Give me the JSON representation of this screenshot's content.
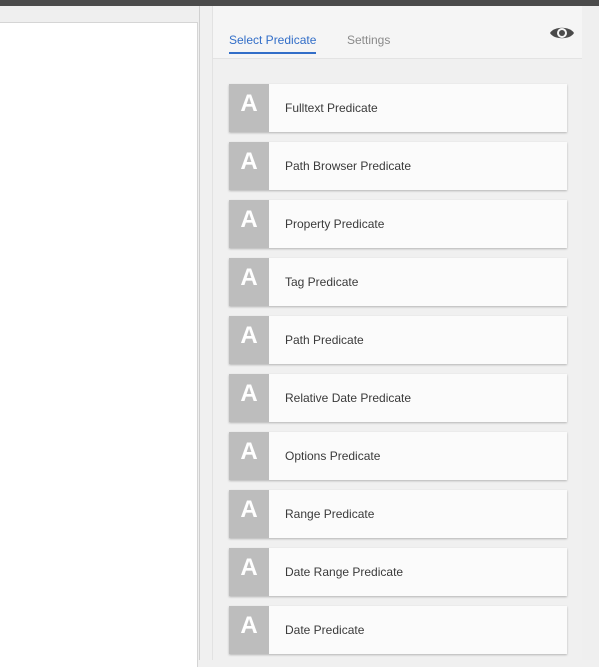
{
  "side_panel": {
    "tabs": [
      {
        "label": "Select Predicate",
        "active": true
      },
      {
        "label": "Settings",
        "active": false
      }
    ],
    "preview_icon": "eye-icon",
    "predicates": [
      {
        "badge": "A",
        "label": "Fulltext Predicate"
      },
      {
        "badge": "A",
        "label": "Path Browser Predicate"
      },
      {
        "badge": "A",
        "label": "Property Predicate"
      },
      {
        "badge": "A",
        "label": "Tag Predicate"
      },
      {
        "badge": "A",
        "label": "Path Predicate"
      },
      {
        "badge": "A",
        "label": "Relative Date Predicate"
      },
      {
        "badge": "A",
        "label": "Options Predicate"
      },
      {
        "badge": "A",
        "label": "Range Predicate"
      },
      {
        "badge": "A",
        "label": "Date Range Predicate"
      },
      {
        "badge": "A",
        "label": "Date Predicate"
      }
    ]
  },
  "colors": {
    "accent": "#326ec8",
    "badge_bg": "#bdbdbd",
    "topbar": "#4b4b4b"
  }
}
